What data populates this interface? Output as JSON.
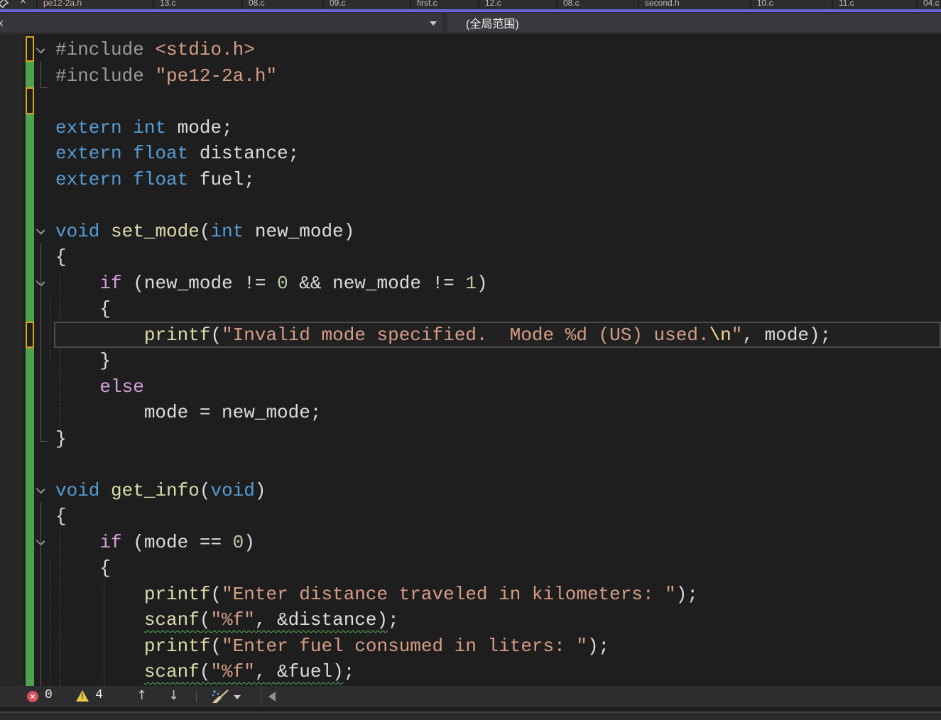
{
  "tab_bar": {
    "close_glyph": "×",
    "tabs": [
      {
        "label": "pe12-2a.h"
      },
      {
        "label": "13.c"
      },
      {
        "label": "08.c"
      },
      {
        "label": "09.c"
      },
      {
        "label": "first.c"
      },
      {
        "label": "12.c"
      },
      {
        "label": "08.c"
      },
      {
        "label": "second.h"
      },
      {
        "label": "10.c"
      },
      {
        "label": "11.c"
      },
      {
        "label": "04.c"
      }
    ]
  },
  "navbar": {
    "left_text_fragment": "x",
    "scope_label": "(全局范围)"
  },
  "editor": {
    "lines": [
      [
        [
          "pp",
          "#include"
        ],
        [
          "pl",
          " "
        ],
        [
          "str",
          "<stdio.h>"
        ]
      ],
      [
        [
          "pp",
          "#include"
        ],
        [
          "pl",
          " "
        ],
        [
          "str",
          "\"pe12-2a.h\""
        ]
      ],
      [],
      [
        [
          "kw",
          "extern"
        ],
        [
          "pl",
          " "
        ],
        [
          "kw",
          "int"
        ],
        [
          "pl",
          " mode;"
        ]
      ],
      [
        [
          "kw",
          "extern"
        ],
        [
          "pl",
          " "
        ],
        [
          "kw",
          "float"
        ],
        [
          "pl",
          " distance;"
        ]
      ],
      [
        [
          "kw",
          "extern"
        ],
        [
          "pl",
          " "
        ],
        [
          "kw",
          "float"
        ],
        [
          "pl",
          " fuel;"
        ]
      ],
      [],
      [
        [
          "kw",
          "void"
        ],
        [
          "pl",
          " "
        ],
        [
          "fn",
          "set_mode"
        ],
        [
          "pl",
          "("
        ],
        [
          "kw",
          "int"
        ],
        [
          "pl",
          " new_mode)"
        ]
      ],
      [
        [
          "pl",
          "{"
        ]
      ],
      [
        [
          "pl",
          "    "
        ],
        [
          "ctrl",
          "if"
        ],
        [
          "pl",
          " (new_mode != "
        ],
        [
          "num",
          "0"
        ],
        [
          "pl",
          " && new_mode != "
        ],
        [
          "num",
          "1"
        ],
        [
          "pl",
          ")"
        ]
      ],
      [
        [
          "pl",
          "    {"
        ]
      ],
      [
        [
          "pl",
          "        "
        ],
        [
          "fn",
          "printf"
        ],
        [
          "pl",
          "("
        ],
        [
          "str",
          "\"Invalid mode specified.  Mode %d (US) used."
        ],
        [
          "esc",
          "\\n"
        ],
        [
          "str",
          "\""
        ],
        [
          "pl",
          ", mode);"
        ]
      ],
      [
        [
          "pl",
          "    }"
        ]
      ],
      [
        [
          "pl",
          "    "
        ],
        [
          "ctrl",
          "else"
        ]
      ],
      [
        [
          "pl",
          "        mode = new_mode;"
        ]
      ],
      [
        [
          "pl",
          "}"
        ]
      ],
      [],
      [
        [
          "kw",
          "void"
        ],
        [
          "pl",
          " "
        ],
        [
          "fn",
          "get_info"
        ],
        [
          "pl",
          "("
        ],
        [
          "kw",
          "void"
        ],
        [
          "pl",
          ")"
        ]
      ],
      [
        [
          "pl",
          "{"
        ]
      ],
      [
        [
          "pl",
          "    "
        ],
        [
          "ctrl",
          "if"
        ],
        [
          "pl",
          " (mode == "
        ],
        [
          "num",
          "0"
        ],
        [
          "pl",
          ")"
        ]
      ],
      [
        [
          "pl",
          "    {"
        ]
      ],
      [
        [
          "pl",
          "        "
        ],
        [
          "fn",
          "printf"
        ],
        [
          "pl",
          "("
        ],
        [
          "str",
          "\"Enter distance traveled in kilometers: \""
        ],
        [
          "pl",
          ");"
        ]
      ],
      [
        [
          "pl",
          "        "
        ],
        [
          "fn",
          "scanf",
          1
        ],
        [
          "pl",
          "(",
          1
        ],
        [
          "str",
          "\"%f\"",
          1
        ],
        [
          "pl",
          ", &distance)",
          1
        ],
        [
          "pl",
          ";"
        ]
      ],
      [
        [
          "pl",
          "        "
        ],
        [
          "fn",
          "printf"
        ],
        [
          "pl",
          "("
        ],
        [
          "str",
          "\"Enter fuel consumed in liters: \""
        ],
        [
          "pl",
          ");"
        ]
      ],
      [
        [
          "pl",
          "        "
        ],
        [
          "fn",
          "scanf",
          1
        ],
        [
          "pl",
          "(",
          1
        ],
        [
          "str",
          "\"%f\"",
          1
        ],
        [
          "pl",
          ", &fuel)",
          1
        ],
        [
          "pl",
          ";"
        ]
      ]
    ]
  },
  "status_bar": {
    "error_count": "0",
    "warning_count": "4",
    "error_glyph": "×",
    "warning_glyph": "!",
    "up_arrow": "↑",
    "down_arrow": "↓"
  },
  "colors": {
    "accent": "#6764D8",
    "trackGreen": "#4EA24E",
    "trackYellow": "#D7A41C",
    "errRed": "#D8505A",
    "warnYellow": "#E8C546",
    "squiggle": "#55B555",
    "curlineBorder": "#4D4D4D",
    "tokPp": "#9B9B9B",
    "tokKw": "#569CD6",
    "tokCtrl": "#D8A0DF",
    "tokFn": "#DCDCAA",
    "tokStr": "#D69D85",
    "tokEsc": "#FFD68F",
    "tokNum": "#B5CEA8",
    "tokPl": "#DCDCDC"
  }
}
